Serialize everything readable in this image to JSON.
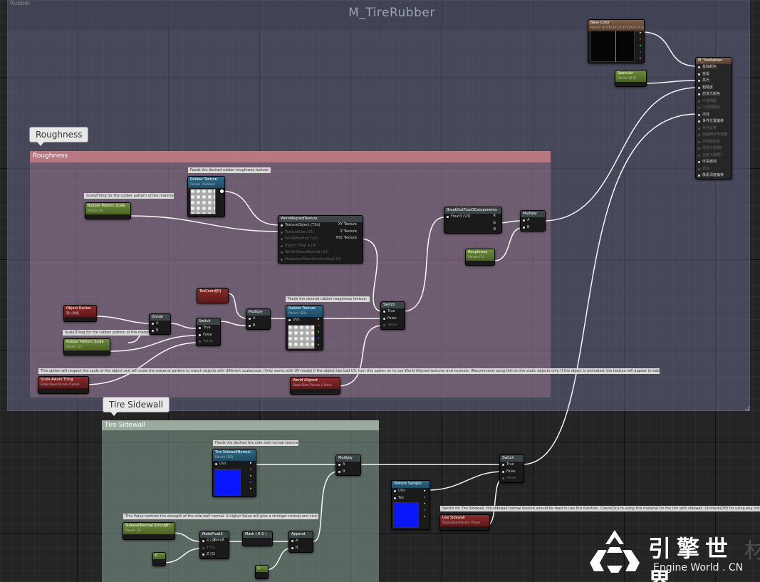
{
  "graph": {
    "top_label": "Rubber",
    "title": "M_TireRubber"
  },
  "groups": {
    "roughness": {
      "bubble": "Roughness",
      "header": "Roughness"
    },
    "sidewall": {
      "bubble": "Tire Sidewall",
      "header": "Tire Sidewall"
    }
  },
  "nodes": {
    "base_color": {
      "title": "Base Color",
      "subtitle": "Param (0.032243,0.032243,0.032243,1)"
    },
    "specular": {
      "title": "Specular",
      "subtitle": "Param (0.5)"
    },
    "output": {
      "title": "M_TireRubber",
      "pins": [
        "基础颜色",
        "金属",
        "高光",
        "粗糙度",
        "自发光颜色",
        "不透明度",
        "不透明蒙板",
        "法线",
        "世界位置偏移",
        "世界位移",
        "曲面细分倍增器",
        "次表面颜色",
        "自定义数据0",
        "自定义数据1",
        "环境遮挡",
        "折射",
        "像素深度偏移"
      ],
      "dim": [
        false,
        false,
        false,
        false,
        false,
        true,
        true,
        false,
        false,
        true,
        true,
        true,
        true,
        true,
        false,
        true,
        false
      ]
    },
    "rubber_texture_1": {
      "title": "Rubber Texture",
      "subtitle": "Param (Rubber)"
    },
    "rubber_pattern_scale_1": {
      "title": "Rubber Pattern Scale",
      "subtitle": "Param (2)"
    },
    "world_aligned": {
      "title": "WorldAlignedTexture",
      "inputs": [
        "TextureObject (T2d)",
        "TextureSize (V3)",
        "WorldPosition (V3)",
        "Export Float 4 (B)",
        "World SpaceNormal (V3)",
        "ProjectionTransitionContrast (S)"
      ],
      "outputs": [
        "XY Texture",
        "Z Texture",
        "XYZ Texture"
      ]
    },
    "break_out": {
      "title": "BreakOutFloat3Components",
      "input": "Float3 (V3)",
      "outputs": [
        "R",
        "G",
        "B"
      ]
    },
    "multiply_top": {
      "title": "Multiply",
      "inputs": [
        "A",
        "B"
      ]
    },
    "roughness_param": {
      "title": "Roughness",
      "subtitle": "Param (1)"
    },
    "object_radius": {
      "title": "Object Radius",
      "subtitle": "输入数据"
    },
    "divide": {
      "title": "Divide",
      "inputs": [
        "A",
        "B"
      ]
    },
    "rubber_pattern_scale_2": {
      "title": "Rubber Pattern Scale",
      "subtitle": "Param (2)"
    },
    "switch_1": {
      "title": "Switch",
      "inputs": [
        "True",
        "False",
        "Value"
      ]
    },
    "texcoord": {
      "title": "TexCoord[0]"
    },
    "multiply_mid": {
      "title": "Multiply",
      "inputs": [
        "A",
        "B"
      ]
    },
    "rubber_texture_2": {
      "title": "Rubber Texture",
      "subtitle": "Param (2D)",
      "input": "UVs"
    },
    "switch_2": {
      "title": "Switch",
      "inputs": [
        "True",
        "False",
        "Value"
      ]
    },
    "scale_aware": {
      "title": "Scale-Aware Tiling",
      "subtitle": "StaticBool Param (False)"
    },
    "world_aligned_bool": {
      "title": "World Aligned",
      "subtitle": "StaticBool Param (False)"
    },
    "sidewall_normal": {
      "title": "Tire SidewallNormal",
      "subtitle": "Param (2D)",
      "input": "UVs"
    },
    "multiply_side": {
      "title": "Multiply",
      "inputs": [
        "A",
        "B"
      ]
    },
    "texture_sample": {
      "title": "Texture Sample",
      "inputs": [
        "UVs",
        "Tex"
      ]
    },
    "switch_side": {
      "title": "Switch",
      "inputs": [
        "True",
        "False",
        "Value"
      ]
    },
    "use_sidewall": {
      "title": "Use Sidewall",
      "subtitle": "StaticBool Param (True)"
    },
    "sidewall_strength": {
      "title": "SidewallNormal Strength",
      "subtitle": "Param (1)"
    },
    "make_float3": {
      "title": "MakeFloat3",
      "inputs": [
        "X (S)",
        "Y (S)",
        "Z (S)"
      ],
      "output": "Result"
    },
    "mask_rg": {
      "title": "Mask ( R G )"
    },
    "append": {
      "title": "Append",
      "inputs": [
        "A",
        "B"
      ]
    },
    "const_0": {
      "title": "0"
    },
    "const_1": {
      "title": "1"
    }
  },
  "comments": {
    "feeds_roughness_1": "Feeds the desired rubber roughness texture",
    "scale_tiling_1": "Scale/Tiling for the rubber pattern of the material",
    "feeds_roughness_2": "Feeds the desired rubber roughness texture",
    "scale_tiling_2": "Scale/Tiling for the rubber pattern of the material",
    "scale_note": "This option will respect the scale of the object and will scale the material pattern to match objects with different scales/size. (Only works with UV mode) If the object has bad UV, turn this option on to use World Aligned textures and normals. (Recommend using this on the static objects only. If the object is animated, the texture will appear to swim when the object moves)",
    "feeds_sidewall": "Feeds the desired tire side wall normal texture",
    "strength_note": "This Value controls the strength of the side wall normal. A higher Value will give a stronger normal and vice versa.",
    "switch_sidewall_note": "Switch for Tire Sidewall, the sidewall normal texture should be feed to use this function. Check(On) to using this material for the tire with sidewall. Uncheck(Off) for using any rubber materials"
  },
  "watermark": {
    "cn": "引擎世界",
    "en": "Engine World . CN",
    "edge": "材"
  },
  "colors": {
    "wire": "#ffffff",
    "param_green": "#5b7a2e",
    "bool_red": "#7a2222",
    "texture_blue": "#2f6b8a",
    "normal_blue": "#0a16ff"
  }
}
